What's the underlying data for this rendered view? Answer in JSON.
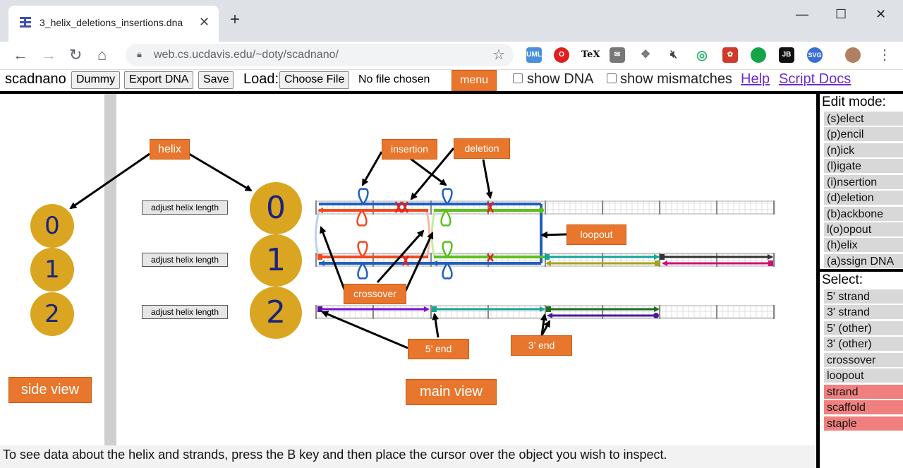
{
  "browser": {
    "tab_title": "3_helix_deletions_insertions.dna",
    "url": "web.cs.ucdavis.edu/~doty/scadnano/"
  },
  "appbar": {
    "app_name": "scadnano",
    "dummy_label": "Dummy",
    "export_label": "Export DNA",
    "save_label": "Save",
    "load_label": "Load:",
    "choose_file_label": "Choose File",
    "no_file_label": "No file chosen",
    "menu_label": "menu",
    "show_dna_label": "show DNA",
    "show_mismatches_label": "show mismatches",
    "help_label": "Help",
    "script_docs_label": "Script Docs"
  },
  "side_view": {
    "helices": [
      "0",
      "1",
      "2"
    ]
  },
  "main_view": {
    "adjust_label": "adjust helix length",
    "helices": [
      "0",
      "1",
      "2"
    ]
  },
  "edit_panel": {
    "edit_mode_title": "Edit mode:",
    "edit_modes": [
      "(s)elect",
      "(p)encil",
      "(n)ick",
      "(l)igate",
      "(i)nsertion",
      "(d)eletion",
      "(b)ackbone",
      "l(o)opout",
      "(h)elix",
      "(a)ssign DNA"
    ],
    "select_title": "Select:",
    "select_items": [
      "5' strand",
      "3' strand",
      "5' (other)",
      "3' (other)",
      "crossover",
      "loopout"
    ],
    "select_items_red": [
      "strand",
      "scaffold",
      "staple"
    ]
  },
  "footer": {
    "text": "To see data about the helix and strands, press the B key and then place the cursor over the object you wish to inspect."
  },
  "annotations": {
    "helix": "helix",
    "insertion": "insertion",
    "deletion": "deletion",
    "loopout": "loopout",
    "crossover": "crossover",
    "five_end": "5’ end",
    "three_end": "3’ end",
    "side_view": "side view",
    "main_view": "main view"
  },
  "colors": {
    "helix_fill": "#daa520",
    "helix_text": "#1a237e",
    "callout": "#e8762c",
    "strand_blue": "#1f5fbf",
    "strand_red": "#f04a1e",
    "strand_green": "#5cbf1e",
    "strand_teal": "#16a596",
    "strand_purple": "#7a12d4",
    "strand_darkgreen": "#1f6e1f",
    "strand_black": "#333333",
    "strand_magenta": "#cc1070"
  }
}
